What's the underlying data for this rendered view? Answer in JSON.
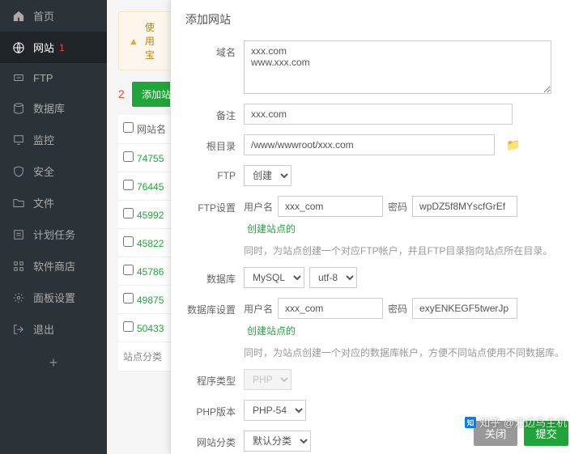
{
  "sidebar": {
    "items": [
      {
        "label": "首页",
        "icon": "home"
      },
      {
        "label": "网站",
        "icon": "globe",
        "badge": "1"
      },
      {
        "label": "FTP",
        "icon": "ftp"
      },
      {
        "label": "数据库",
        "icon": "db"
      },
      {
        "label": "监控",
        "icon": "monitor"
      },
      {
        "label": "安全",
        "icon": "shield"
      },
      {
        "label": "文件",
        "icon": "folder"
      },
      {
        "label": "计划任务",
        "icon": "task"
      },
      {
        "label": "软件商店",
        "icon": "store"
      },
      {
        "label": "面板设置",
        "icon": "settings"
      },
      {
        "label": "退出",
        "icon": "logout"
      }
    ],
    "add": "+"
  },
  "main": {
    "warning": "使用宝",
    "add_badge": "2",
    "add_button": "添加站点",
    "table": {
      "header": "网站名",
      "rows": [
        "74755",
        "76445",
        "45992",
        "45822",
        "45786",
        "49875",
        "50433"
      ],
      "category": "站点分类"
    }
  },
  "modal": {
    "title": "添加网站",
    "domain_label": "域名",
    "domain_value": "xxx.com\nwww.xxx.com",
    "remark_label": "备注",
    "remark_value": "xxx.com",
    "root_label": "根目录",
    "root_value": "/www/wwwroot/xxx.com",
    "ftp_label": "FTP",
    "ftp_value": "创建",
    "ftp_settings_label": "FTP设置",
    "user_label": "用户名",
    "ftp_user": "xxx_com",
    "pwd_label": "密码",
    "ftp_pwd": "wpDZ5f8MYscfGrEf",
    "create_link": "创建站点的",
    "ftp_hint": "同时，为站点创建一个对应FTP帐户，并且FTP目录指向站点所在目录。",
    "db_label": "数据库",
    "db_type": "MySQL",
    "db_charset": "utf-8",
    "db_settings_label": "数据库设置",
    "db_user": "xxx_com",
    "db_pwd": "exyENKEGF5twerJp",
    "db_hint": "同时，为站点创建一个对应的数据库帐户，方便不同站点使用不同数据库。",
    "program_label": "程序类型",
    "program_value": "PHP",
    "php_label": "PHP版本",
    "php_value": "PHP-54",
    "category_label": "网站分类",
    "category_value": "默认分类",
    "cancel": "关闭",
    "submit": "提交"
  },
  "watermark": "知乎 @江边鸟主机"
}
